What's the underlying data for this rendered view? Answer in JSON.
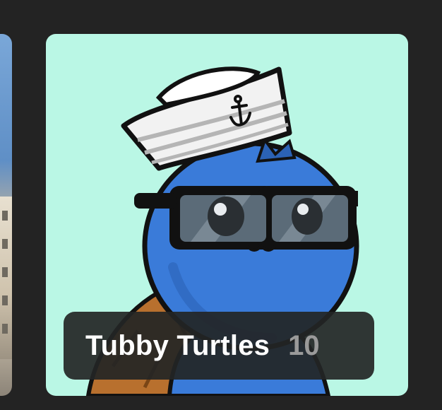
{
  "collection": {
    "name": "Tubby Turtles",
    "count": "10"
  },
  "colors": {
    "page_background": "#232323",
    "card_background": "#baf7e5",
    "turtle_skin": "#3a7bd9",
    "shell": "#b8702e",
    "label_background": "#2b2d2d",
    "label_text": "#ffffff",
    "count_text": "#9a9a9a"
  },
  "icons": {
    "hat_emblem": "anchor-icon"
  }
}
